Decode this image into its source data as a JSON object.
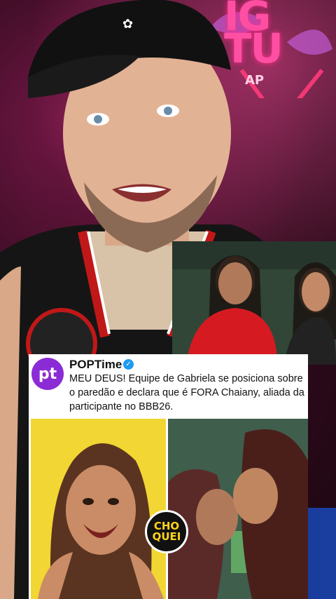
{
  "background": {
    "logo_text": "IG\nTU",
    "logo_sub": "AP"
  },
  "post": {
    "avatar_label": "pt",
    "account_name": "POPTime",
    "verified_icon": "verified-check-icon",
    "text": "MEU DEUS! Equipe de Gabriela se posiciona sobre o paredão e declara que é FORA Chaiany, aliada da participante no BBB26.",
    "badge_line1": "CHO",
    "badge_line2": "QUEI"
  },
  "colors": {
    "avatar": "#8b2bd6",
    "verified": "#1d9bf0",
    "badge_text": "#ffd21a",
    "left_photo_bg": "#f2d633"
  }
}
